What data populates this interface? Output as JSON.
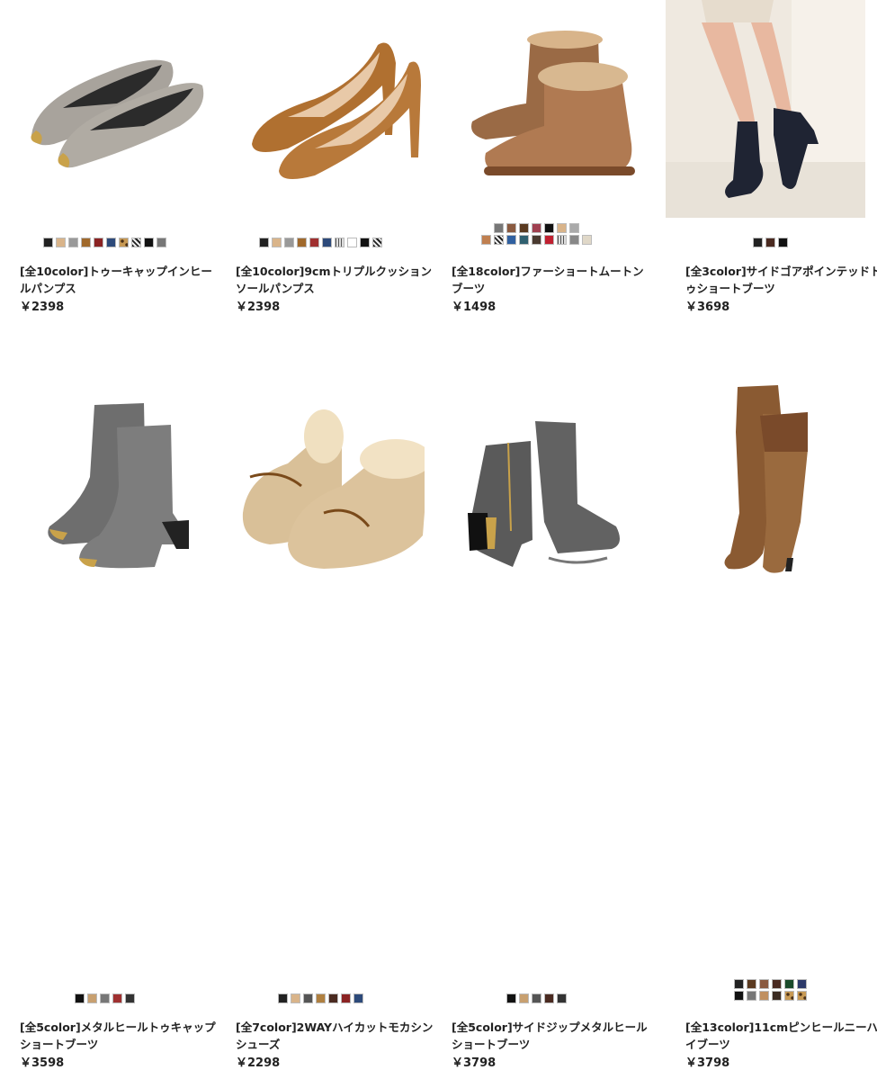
{
  "products": [
    {
      "title": "[全10color]トゥーキャップインヒールパンプス",
      "price": "￥2398",
      "image": "gray-suede-pumps-gold-toecap",
      "swatch_rows": [
        [
          "#222222",
          "#d9b48a",
          "#999999",
          "#a0692c",
          "#8b2323",
          "#2d4a7a",
          "#pat-leo",
          "#pat-check",
          "#111111",
          "#777777"
        ]
      ]
    },
    {
      "title": "[全10color]9cmトリプルクッションソールパンプス",
      "price": "￥2398",
      "image": "camel-suede-pumps",
      "swatch_rows": [
        [
          "#222222",
          "#d9b48a",
          "#999999",
          "#a0692c",
          "#a03030",
          "#2d4a7a",
          "#pat-tweed",
          "#ffffff",
          "#111111",
          "#pat-check"
        ]
      ]
    },
    {
      "title": "[全18color]ファーショートムートンブーツ",
      "price": "￥1498",
      "image": "brown-mouton-boots",
      "swatch_rows": [
        [
          "#777777",
          "#8a5a40",
          "#5a3a20",
          "#a04050",
          "#111111",
          "#d9b48a",
          "#aaaaaa"
        ],
        [
          "#c08050",
          "#pat-check",
          "#3060a0",
          "#306070",
          "#4a3a30",
          "#c02030",
          "#pat-tweed",
          "#888888",
          "#e0d8c8"
        ]
      ]
    },
    {
      "title": "[全3color]サイドゴアポインテッドトゥショートブーツ",
      "price": "￥3698",
      "image": "model-black-short-boots",
      "swatch_rows": [
        [
          "#222222",
          "#4a2a20",
          "#111111"
        ]
      ]
    },
    {
      "title": "[全5color]メタルヒールトゥキャップショートブーツ",
      "price": "￥3598",
      "image": "gray-metal-heel-boots",
      "swatch_rows": [
        [
          "#111111",
          "#c8a070",
          "#777777",
          "#a03030",
          "#333333"
        ]
      ]
    },
    {
      "title": "[全7color]2WAYハイカットモカシンシューズ",
      "price": "￥2298",
      "image": "beige-fur-moccasins",
      "swatch_rows": [
        [
          "#222222",
          "#d9b48a",
          "#555555",
          "#b08040",
          "#4a2a20",
          "#8b2323",
          "#2d4a7a"
        ]
      ]
    },
    {
      "title": "[全5color]サイドジップメタルヒールショートブーツ",
      "price": "￥3798",
      "image": "gray-side-zip-boots",
      "swatch_rows": [
        [
          "#111111",
          "#c8a070",
          "#555555",
          "#4a2a20",
          "#333333"
        ]
      ]
    },
    {
      "title": "[全13color]11cmピンヒールニーハイブーツ",
      "price": "￥3798",
      "image": "brown-knee-high-boots",
      "swatch_rows": [
        [
          "#222222",
          "#5a3a20",
          "#8a5a40",
          "#4a2a20",
          "#1a4a2a",
          "#2d3a6a"
        ],
        [
          "#111111",
          "#777777",
          "#c09060",
          "#3a2a20",
          "#pat-leo",
          "#pat-leo"
        ]
      ]
    }
  ]
}
